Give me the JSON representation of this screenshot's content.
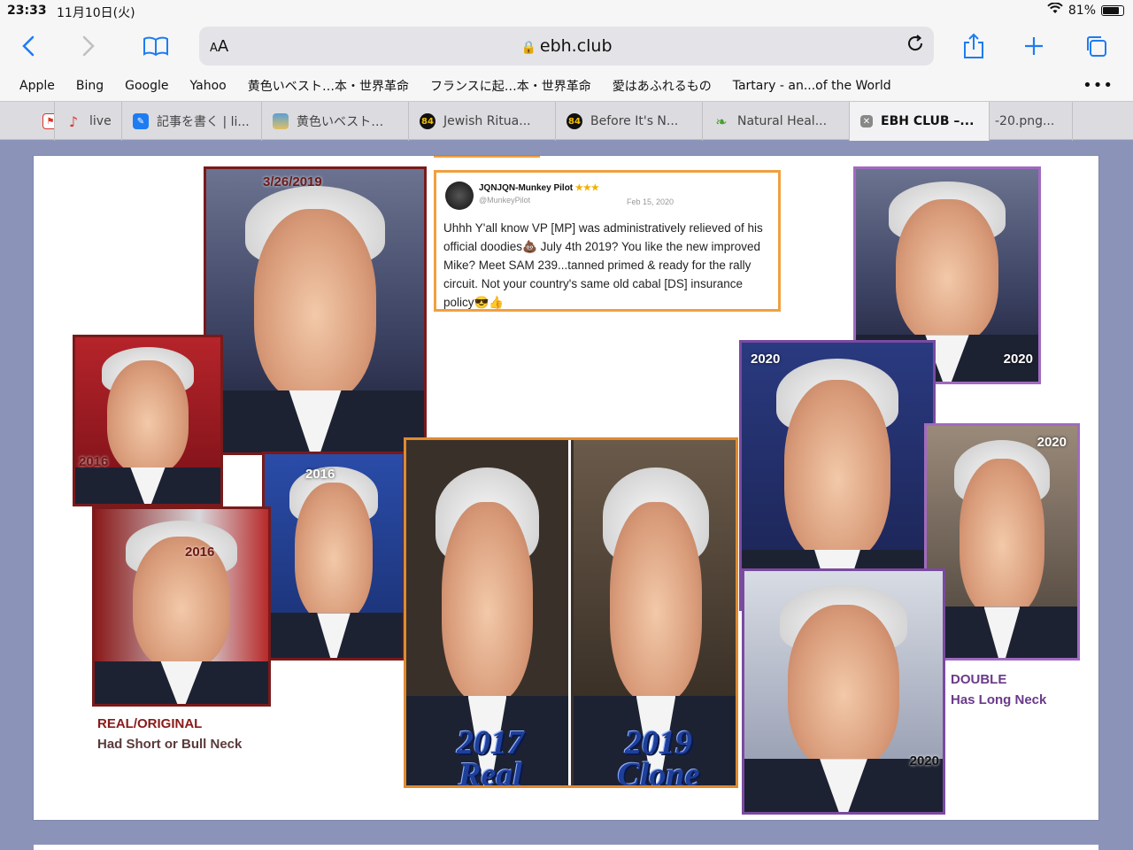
{
  "status": {
    "time": "23:33",
    "date": "11月10日(火)",
    "battery": "81%",
    "battery_level": 0.81
  },
  "toolbar": {
    "aa": "AA",
    "url": "ebh.club"
  },
  "bookmarks": [
    "Apple",
    "Bing",
    "Google",
    "Yahoo",
    "黄色いベスト…本・世界革命",
    "フランスに起…本・世界革命",
    "愛はあふれるもの",
    "Tartary - an...of the World"
  ],
  "tabs": [
    {
      "label": "",
      "icon": "flag-icon",
      "color": "#d9342b"
    },
    {
      "label": "live",
      "icon": "music-icon",
      "color": "#d9342b"
    },
    {
      "label": "記事を書く | li...",
      "icon": "feather-icon",
      "color": "#1e7cf2"
    },
    {
      "label": "黄色いベスト…",
      "icon": "landscape-icon",
      "color": "#5aa0d8"
    },
    {
      "label": "Jewish Ritua...",
      "icon": "badge-84-icon",
      "color": "#111111"
    },
    {
      "label": "Before It's N...",
      "icon": "badge-84-icon",
      "color": "#111111"
    },
    {
      "label": "Natural Heal...",
      "icon": "leaf-icon",
      "color": "#4aa030"
    },
    {
      "label": "EBH CLUB –...",
      "icon": "close-icon",
      "color": "#888888",
      "active": true
    },
    {
      "label": "-20.png...",
      "icon": "",
      "color": "#888888"
    }
  ],
  "photos": {
    "p1": "3/26/2019",
    "p2": "2016",
    "p3": "2016",
    "p4": "2016",
    "p5": "2020",
    "p6a": "2020",
    "p6b": "2020",
    "p7": "2020",
    "p8": "2020"
  },
  "tweet": {
    "name": "JQNJQN-Munkey Pilot",
    "stars": "★★★",
    "handle": "@MunkeyPilot",
    "date": "Feb 15, 2020",
    "body": "Uhhh Y'all know VP [MP] was administratively relieved of his official doodies💩 July 4th 2019? You like the new improved Mike? Meet SAM 239...tanned primed & ready for the rally circuit. Not your country's same old cabal [DS] insurance policy😎👍"
  },
  "captions": {
    "left_1": "REAL/ORIGINAL",
    "left_2": "Had Short or Bull Neck",
    "right_1": "DOUBLE",
    "right_2": "Has Long Neck",
    "real_year": "2017",
    "real_word": "Real",
    "clone_year": "2019",
    "clone_word": "Clone"
  }
}
